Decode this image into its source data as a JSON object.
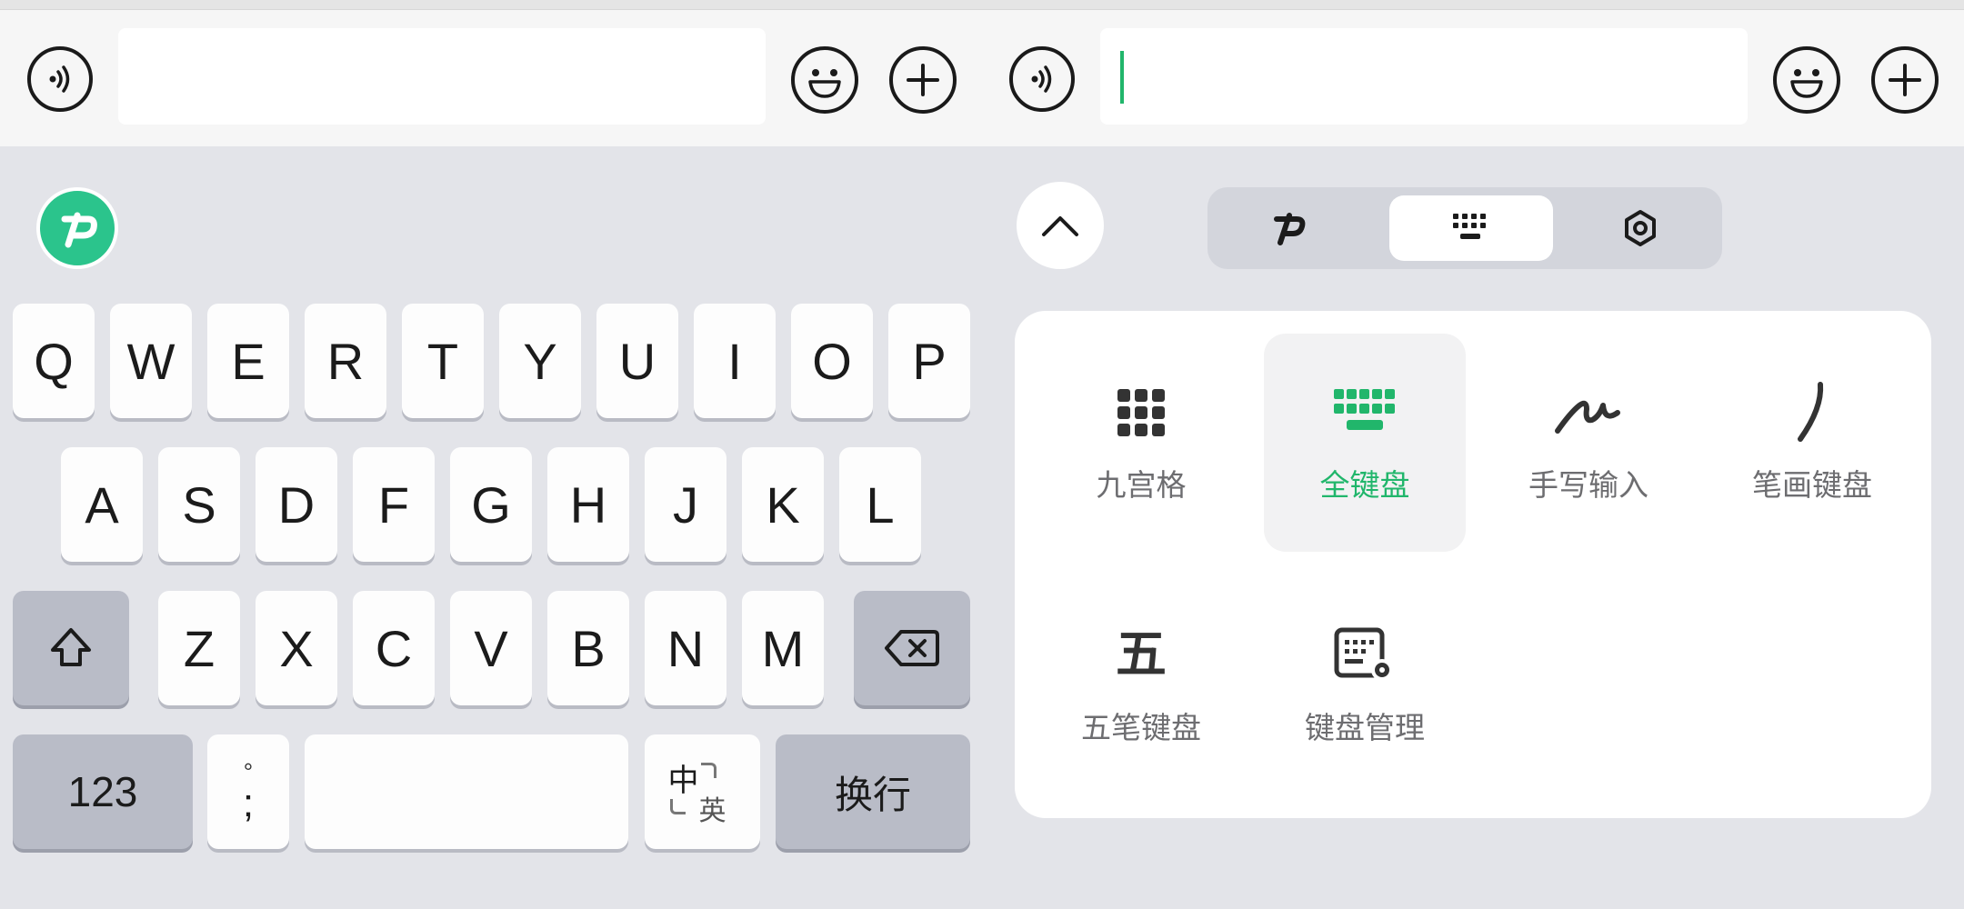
{
  "left": {
    "keyboard": {
      "row1": [
        "Q",
        "W",
        "E",
        "R",
        "T",
        "Y",
        "U",
        "I",
        "O",
        "P"
      ],
      "row2": [
        "A",
        "S",
        "D",
        "F",
        "G",
        "H",
        "J",
        "K",
        "L"
      ],
      "row3": [
        "Z",
        "X",
        "C",
        "V",
        "B",
        "N",
        "M"
      ],
      "bottom": {
        "numbers_label": "123",
        "punct_top": "°",
        "punct_bottom": ";",
        "lang_top": "中",
        "lang_bottom": "英",
        "enter_label": "换行"
      }
    }
  },
  "right": {
    "tabs": [
      {
        "name": "logo-tab"
      },
      {
        "name": "keyboard-tab",
        "active": true
      },
      {
        "name": "settings-tab"
      }
    ],
    "layouts": [
      {
        "label": "九宫格",
        "icon": "nine-grid-icon",
        "selected": false
      },
      {
        "label": "全键盘",
        "icon": "full-keyboard-icon",
        "selected": true
      },
      {
        "label": "手写输入",
        "icon": "handwriting-icon",
        "selected": false
      },
      {
        "label": "笔画键盘",
        "icon": "stroke-icon",
        "selected": false
      },
      {
        "label": "五笔键盘",
        "icon": "wubi-icon",
        "icon_text": "五",
        "selected": false
      },
      {
        "label": "键盘管理",
        "icon": "keyboard-settings-icon",
        "selected": false
      }
    ]
  },
  "colors": {
    "accent": "#21b66b",
    "logo": "#2bc48c",
    "key": "#fdfdfd",
    "function_key": "#b9bcc7",
    "background": "#e3e4e9"
  }
}
